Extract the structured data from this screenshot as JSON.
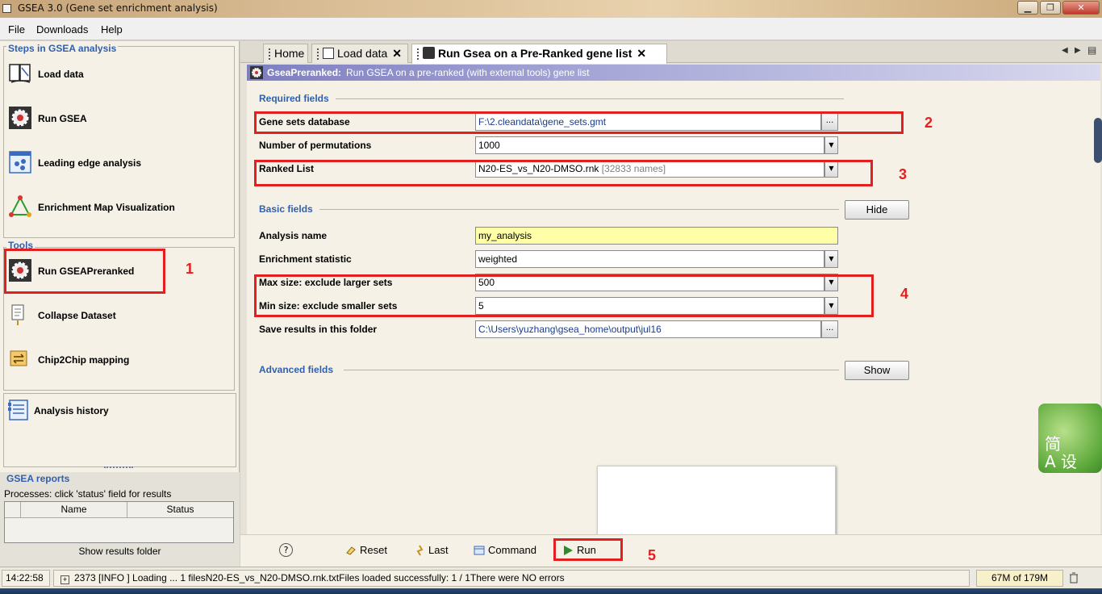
{
  "window": {
    "title": "GSEA 3.0 (Gene set enrichment analysis)",
    "min": "▁",
    "max": "❐",
    "close": "✕"
  },
  "menu": {
    "file": "File",
    "downloads": "Downloads",
    "help": "Help"
  },
  "left": {
    "steps_title": "Steps in GSEA analysis",
    "steps": [
      "Load data",
      "Run GSEA",
      "Leading edge analysis",
      "Enrichment Map Visualization"
    ],
    "tools_title": "Tools",
    "tools": [
      "Run GSEAPreranked",
      "Collapse Dataset",
      "Chip2Chip mapping"
    ],
    "history": "Analysis history"
  },
  "reports": {
    "title": "GSEA reports",
    "hint": "Processes: click 'status' field for results",
    "col_name": "Name",
    "col_status": "Status",
    "show_folder": "Show results folder"
  },
  "tabs": {
    "home": "Home",
    "load": "Load data",
    "run": "Run Gsea on a Pre-Ranked gene list",
    "close": "✕",
    "prev": "◀",
    "next": "▶",
    "menu": "▤"
  },
  "header": {
    "title": "GseaPreranked:",
    "desc": "Run GSEA on a pre-ranked (with external tools) gene list"
  },
  "required": {
    "title": "Required fields",
    "gene_sets_label": "Gene sets database",
    "gene_sets_value": "F:\\2.cleandata\\gene_sets.gmt",
    "perm_label": "Number of permutations",
    "perm_value": "1000",
    "ranked_label": "Ranked List",
    "ranked_value": "N20-ES_vs_N20-DMSO.rnk",
    "ranked_hint": "[32833 names]"
  },
  "basic": {
    "title": "Basic fields",
    "hide": "Hide",
    "name_label": "Analysis name",
    "name_value": "my_analysis",
    "stat_label": "Enrichment statistic",
    "stat_value": "weighted",
    "max_label": "Max size: exclude larger sets",
    "max_value": "500",
    "min_label": "Min size: exclude smaller sets",
    "min_value": "5",
    "folder_label": "Save results in this folder",
    "folder_value": "C:\\Users\\yuzhang\\gsea_home\\output\\jul16"
  },
  "advanced": {
    "title": "Advanced fields",
    "show": "Show"
  },
  "buttons": {
    "help": "?",
    "reset": "Reset",
    "last": "Last",
    "command": "Command",
    "run": "Run",
    "browse": "...",
    "dropdown": "▼"
  },
  "annotations": [
    "1",
    "2",
    "3",
    "4",
    "5"
  ],
  "status": {
    "time": "14:22:58",
    "message": "2373 [INFO ] Loading ... 1 filesN20-ES_vs_N20-DMSO.rnk.txtFiles loaded successfully: 1 / 1There were NO errors",
    "memory_used": "67M",
    "memory_total": "of 179M"
  },
  "widget": {
    "line1": "简",
    "line2": "A 设"
  },
  "colors": {
    "annotation_red": "#e32020",
    "section_blue": "#2f5fb0",
    "header_purple": "#7e7fc0",
    "field_yellow": "#ffffa8"
  }
}
